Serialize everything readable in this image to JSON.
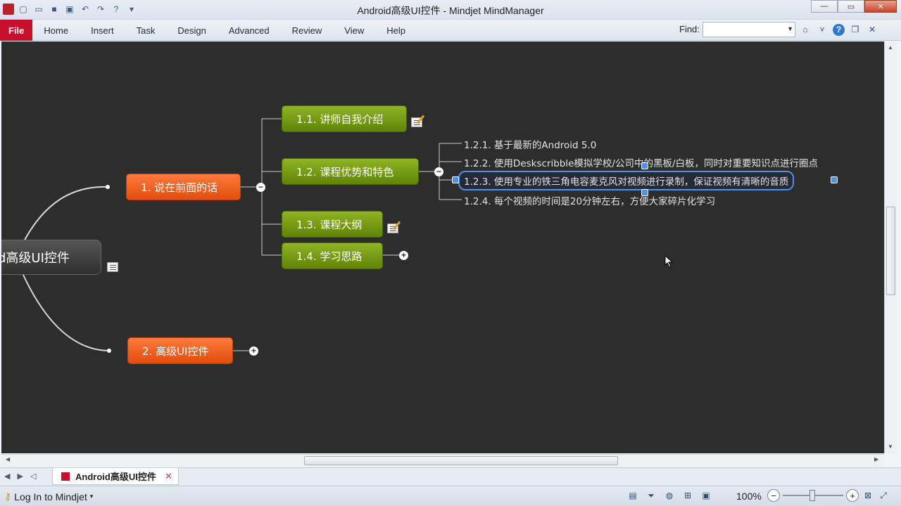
{
  "window": {
    "title": "Android高级UI控件 - Mindjet MindManager"
  },
  "ribbon": {
    "file_tab": "File",
    "tabs": [
      "Home",
      "Insert",
      "Task",
      "Design",
      "Advanced",
      "Review",
      "View",
      "Help"
    ],
    "find_label": "Find:",
    "find_value": ""
  },
  "map": {
    "central": "d高级UI控件",
    "main_topics": [
      {
        "label": "1. 说在前面的话"
      },
      {
        "label": "2. 高级UI控件"
      }
    ],
    "subtopics": [
      {
        "label": "1.1. 讲师自我介绍"
      },
      {
        "label": "1.2. 课程优势和特色"
      },
      {
        "label": "1.3. 课程大纲"
      },
      {
        "label": "1.4. 学习思路"
      }
    ],
    "details": [
      {
        "label": "1.2.1. 基于最新的Android 5.0"
      },
      {
        "label": "1.2.2. 使用Deskscribble模拟学校/公司中的黑板/白板，同时对重要知识点进行圈点"
      },
      {
        "label": "1.2.3. 使用专业的铁三角电容麦克风对视频进行录制，保证视频有清晰的音质"
      },
      {
        "label": "1.2.4. 每个视频的时间是20分钟左右，方便大家碎片化学习"
      }
    ]
  },
  "doc_tabs": {
    "active": "Android高级UI控件"
  },
  "status": {
    "login": "Log In to Mindjet",
    "zoom": "100%"
  },
  "colors": {
    "canvas": "#2d2d2d",
    "main_topic": "#e85a18",
    "subtopic": "#7aa018",
    "selection": "#4f90e8",
    "file_tab": "#c8102e"
  }
}
